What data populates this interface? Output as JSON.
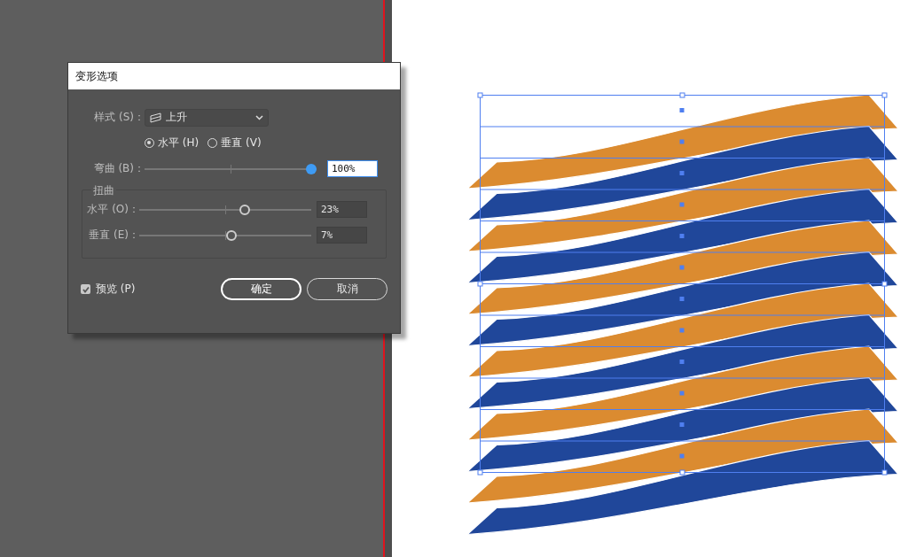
{
  "dialog": {
    "title": "变形选项",
    "style": {
      "label": "样式 (S)：",
      "value": "上升"
    },
    "orientation": [
      {
        "label": "水平 (H)",
        "selected": true
      },
      {
        "label": "垂直 (V)",
        "selected": false
      }
    ],
    "bend": {
      "label": "弯曲 (B)：",
      "level": 1,
      "value": "100%"
    },
    "distortion": {
      "title": "扭曲",
      "sliders": [
        {
          "label": "水平 (O)：",
          "level": 0.615,
          "value": "23%"
        },
        {
          "label": "垂直 (E)：",
          "level": 0.535,
          "value": "7%"
        }
      ]
    },
    "preview": {
      "label": "预览 (P)",
      "checked": true
    },
    "buttons": [
      "确定",
      "取消"
    ]
  }
}
